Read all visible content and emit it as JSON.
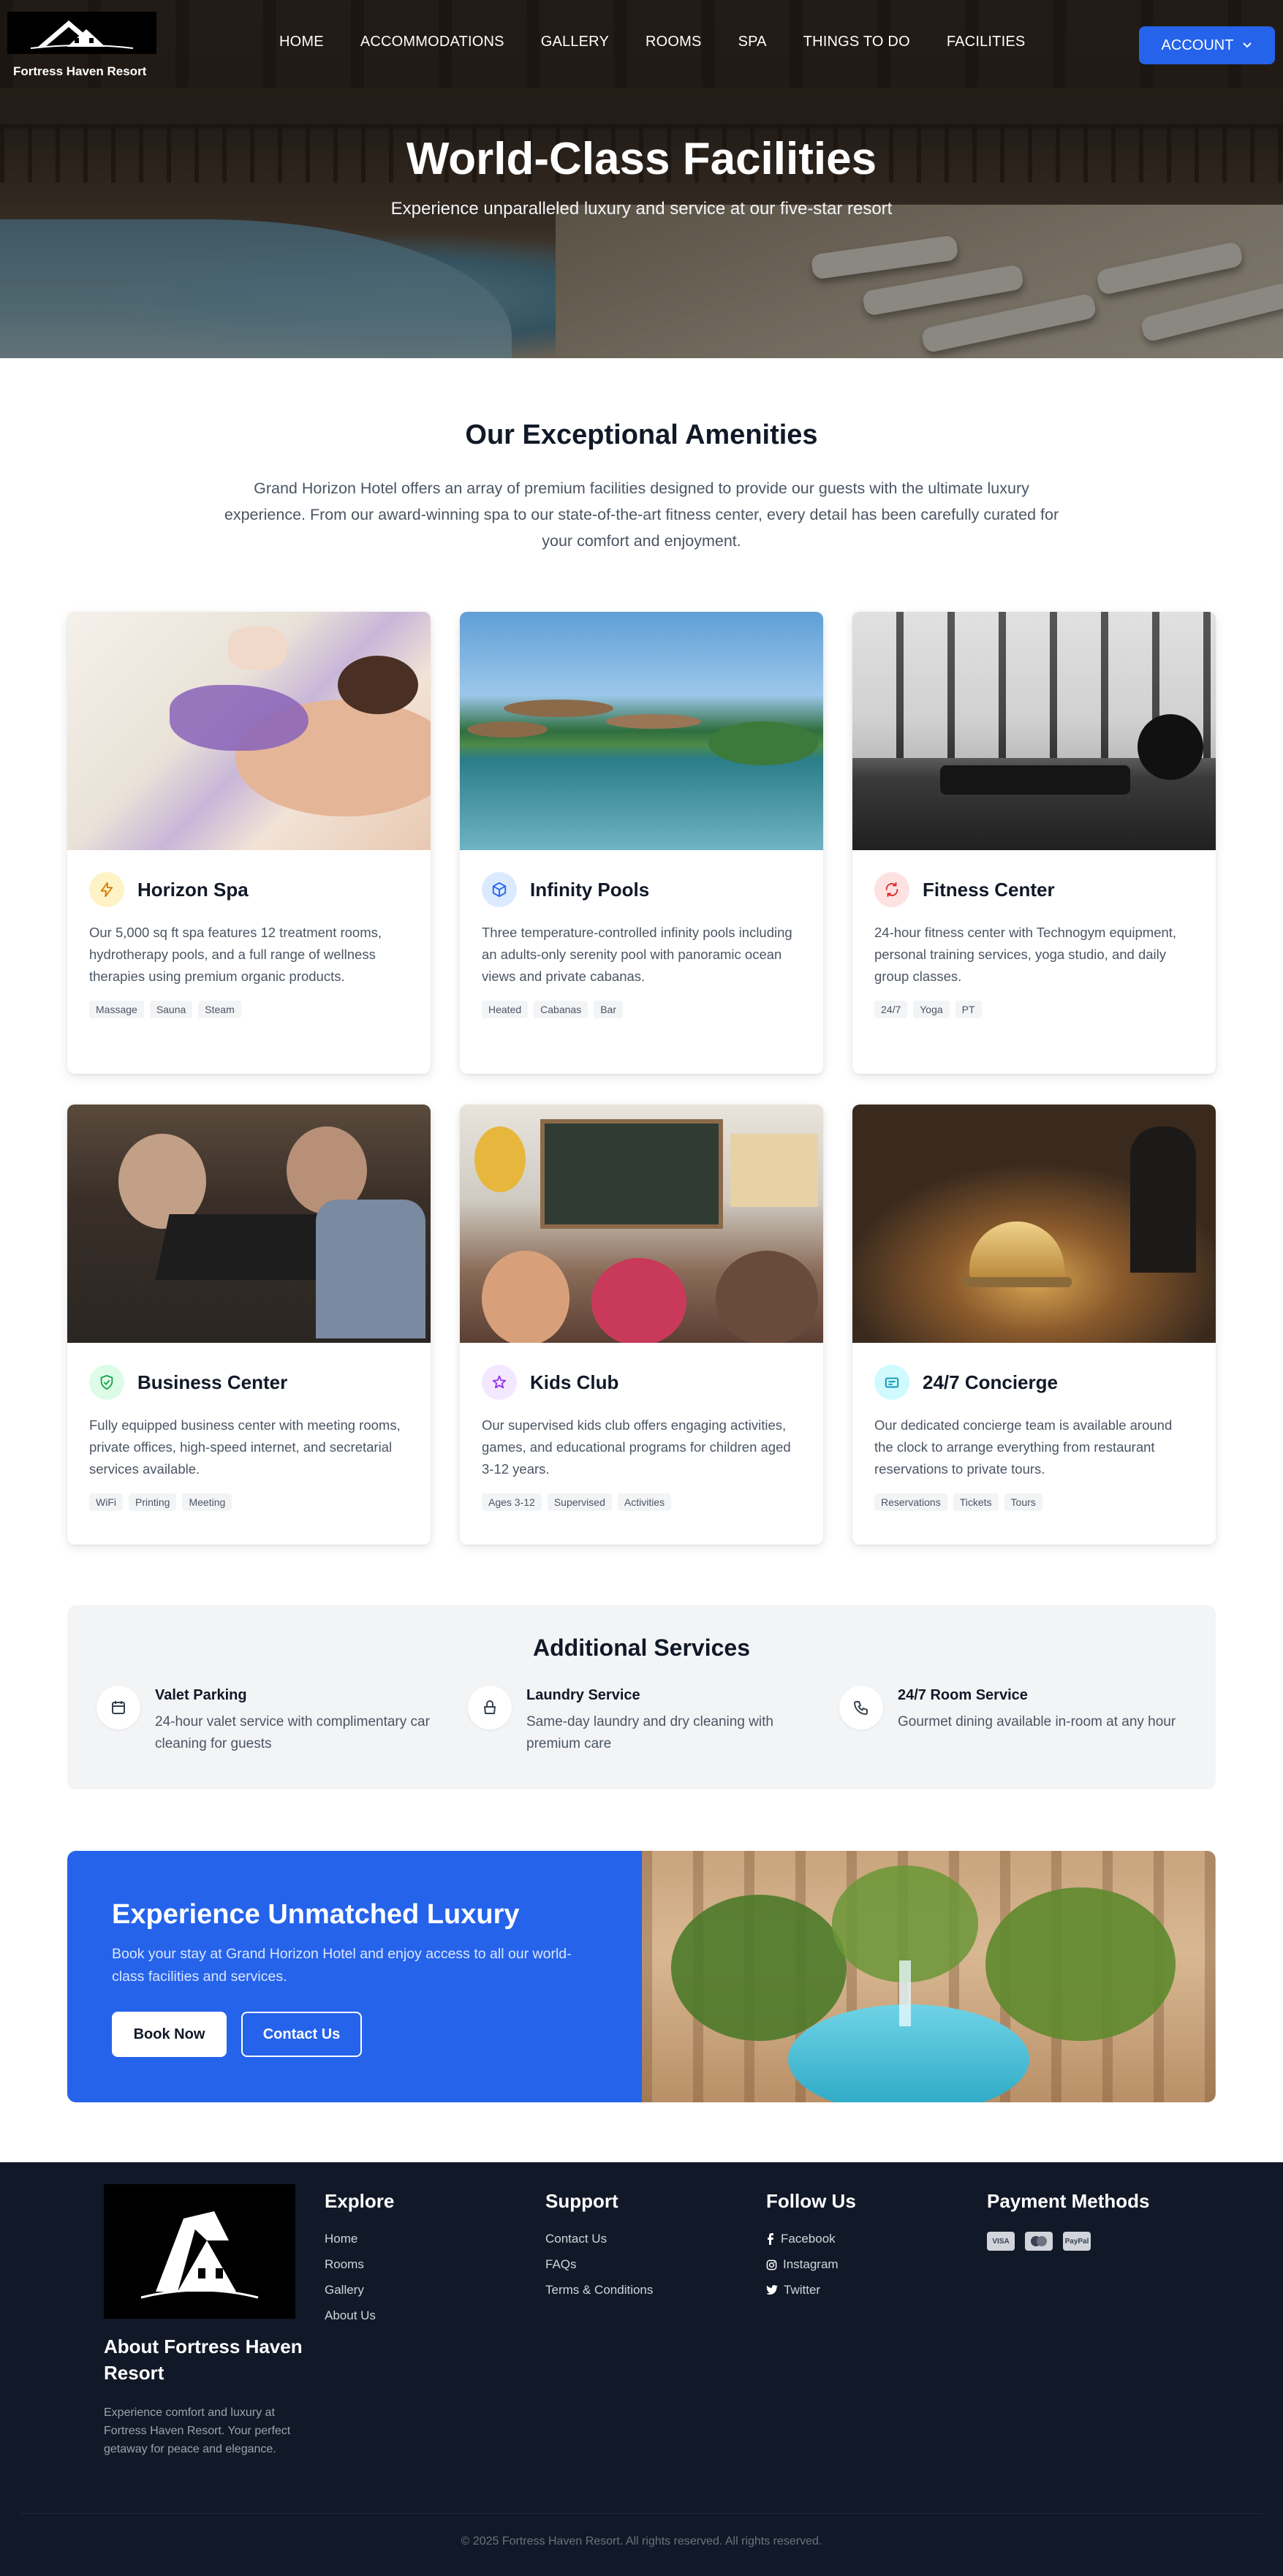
{
  "brand": {
    "name": "Fortress Haven Resort"
  },
  "nav": {
    "items": [
      "HOME",
      "ACCOMMODATIONS",
      "GALLERY",
      "ROOMS",
      "SPA",
      "THINGS TO DO",
      "FACILITIES"
    ],
    "account_label": "ACCOUNT"
  },
  "hero": {
    "title": "World-Class Facilities",
    "subtitle": "Experience unparalleled luxury and service at our five-star resort"
  },
  "intro": {
    "title": "Our Exceptional Amenities",
    "text": "Grand Horizon Hotel offers an array of premium facilities designed to provide our guests with the ultimate luxury experience. From our award-winning spa to our state-of-the-art fitness center, every detail has been carefully curated for your comfort and enjoyment."
  },
  "facilities": [
    {
      "title": "Horizon Spa",
      "icon": "bolt-icon",
      "icon_color": "#d97706",
      "icon_bg": "#fef3c7",
      "text": "Our 5,000 sq ft spa features 12 treatment rooms, hydrotherapy pools, and a full range of wellness therapies using premium organic products.",
      "tags": [
        "Massage",
        "Sauna",
        "Steam"
      ]
    },
    {
      "title": "Infinity Pools",
      "icon": "cube-icon",
      "icon_color": "#2563eb",
      "icon_bg": "#dbeafe",
      "text": "Three temperature-controlled infinity pools including an adults-only serenity pool with panoramic ocean views and private cabanas.",
      "tags": [
        "Heated",
        "Cabanas",
        "Bar"
      ]
    },
    {
      "title": "Fitness Center",
      "icon": "refresh-icon",
      "icon_color": "#dc2626",
      "icon_bg": "#fee2e2",
      "text": "24-hour fitness center with Technogym equipment, personal training services, yoga studio, and daily group classes.",
      "tags": [
        "24/7",
        "Yoga",
        "PT"
      ]
    },
    {
      "title": "Business Center",
      "icon": "shield-check-icon",
      "icon_color": "#16a34a",
      "icon_bg": "#dcfce7",
      "text": "Fully equipped business center with meeting rooms, private offices, high-speed internet, and secretarial services available.",
      "tags": [
        "WiFi",
        "Printing",
        "Meeting"
      ]
    },
    {
      "title": "Kids Club",
      "icon": "star-icon",
      "icon_color": "#9333ea",
      "icon_bg": "#f3e8ff",
      "text": "Our supervised kids club offers engaging activities, games, and educational programs for children aged 3-12 years.",
      "tags": [
        "Ages 3-12",
        "Supervised",
        "Activities"
      ]
    },
    {
      "title": "24/7 Concierge",
      "icon": "card-icon",
      "icon_color": "#0891b2",
      "icon_bg": "#cffafe",
      "text": "Our dedicated concierge team is available around the clock to arrange everything from restaurant reservations to private tours.",
      "tags": [
        "Reservations",
        "Tickets",
        "Tours"
      ]
    }
  ],
  "additional": {
    "title": "Additional Services",
    "items": [
      {
        "title": "Valet Parking",
        "icon": "calendar-icon",
        "text": "24-hour valet service with complimentary car cleaning for guests"
      },
      {
        "title": "Laundry Service",
        "icon": "basket-icon",
        "text": "Same-day laundry and dry cleaning with premium care"
      },
      {
        "title": "24/7 Room Service",
        "icon": "phone-icon",
        "text": "Gourmet dining available in-room at any hour"
      }
    ]
  },
  "cta": {
    "title": "Experience Unmatched Luxury",
    "text": "Book your stay at Grand Horizon Hotel and enjoy access to all our world-class facilities and services.",
    "primary_label": "Book Now",
    "secondary_label": "Contact Us"
  },
  "footer": {
    "about_title": "About Fortress Haven Resort",
    "about_text": "Experience comfort and luxury at Fortress Haven Resort. Your perfect getaway for peace and elegance.",
    "explore": {
      "title": "Explore",
      "links": [
        "Home",
        "Rooms",
        "Gallery",
        "About Us"
      ]
    },
    "support": {
      "title": "Support",
      "links": [
        "Contact Us",
        "FAQs",
        "Terms & Conditions"
      ]
    },
    "follow": {
      "title": "Follow Us",
      "links": [
        "Facebook",
        "Instagram",
        "Twitter"
      ]
    },
    "payment": {
      "title": "Payment Methods",
      "methods": [
        "VISA",
        "MC",
        "PayPal"
      ]
    },
    "copyright": "© 2025 Fortress Haven Resort. All rights reserved. All rights reserved."
  },
  "colors": {
    "accent": "#2563eb",
    "footer_bg": "#111827",
    "panel_bg": "#f3f4f6"
  }
}
